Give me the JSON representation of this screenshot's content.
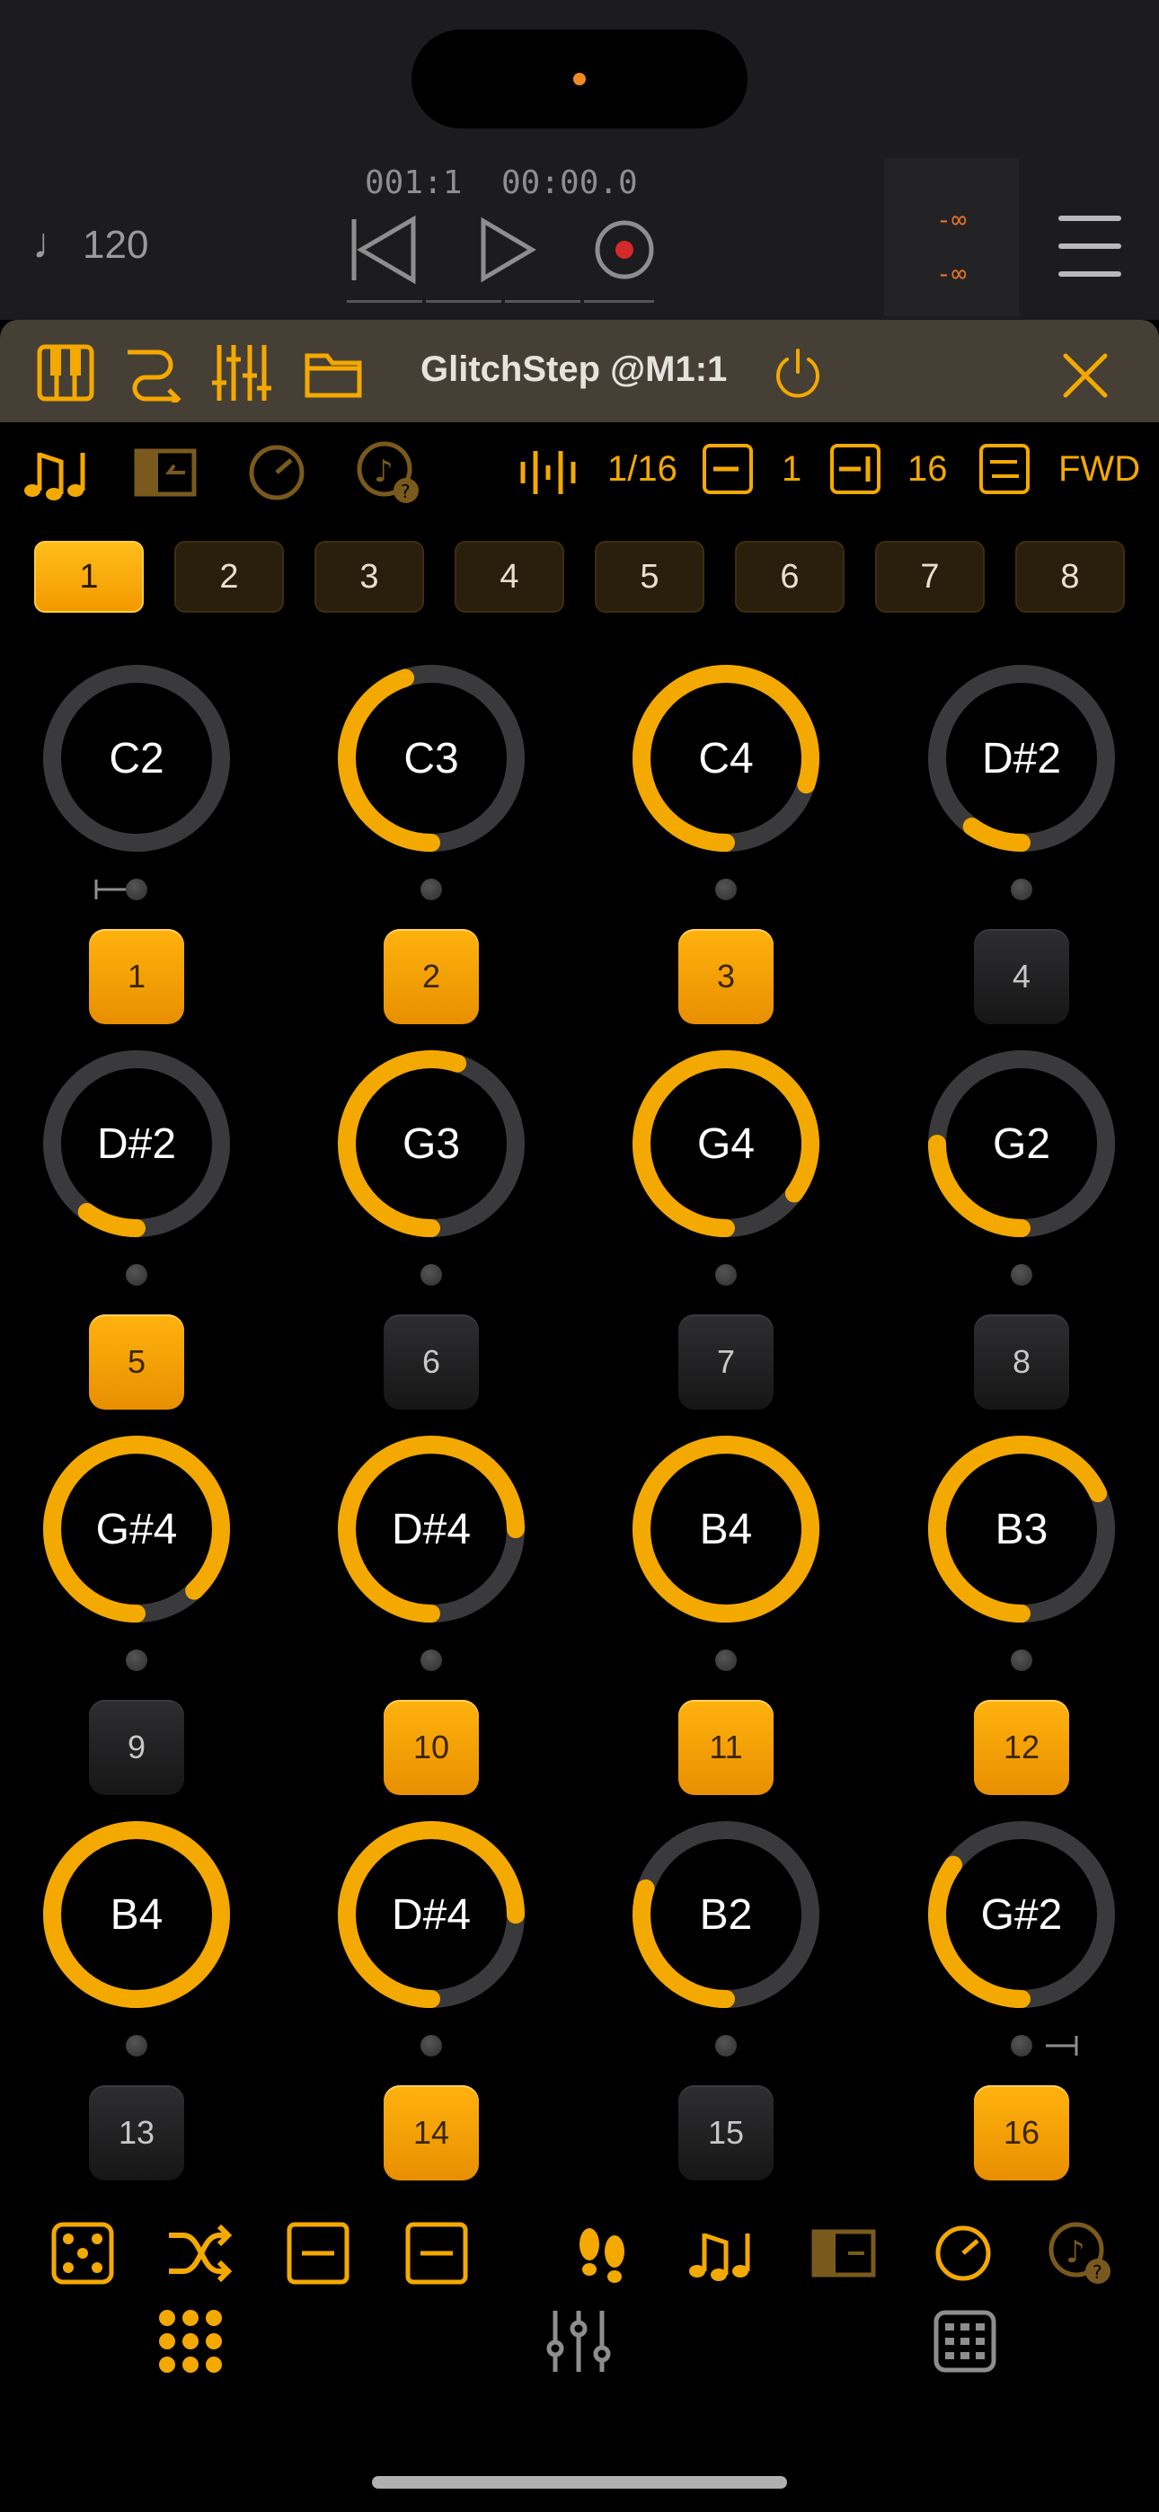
{
  "transport": {
    "tempo": "120",
    "tempo_icon": "note-icon",
    "position_bars": "001:1",
    "position_time": "00:00.0",
    "meter_left": "-∞",
    "meter_right": "-∞"
  },
  "plugin": {
    "title": "GlitchStep @M1:1"
  },
  "toolbar": {
    "division": "1/16",
    "start_step": "1",
    "end_step": "16",
    "direction": "FWD"
  },
  "patterns": [
    "1",
    "2",
    "3",
    "4",
    "5",
    "6",
    "7",
    "8"
  ],
  "selected_pattern": "1",
  "steps": [
    {
      "note": "C2",
      "level": 0.0,
      "button": "1",
      "on": true
    },
    {
      "note": "C3",
      "level": 0.45,
      "button": "2",
      "on": true
    },
    {
      "note": "C4",
      "level": 0.8,
      "button": "3",
      "on": true
    },
    {
      "note": "D#2",
      "level": 0.1,
      "button": "4",
      "on": false
    },
    {
      "note": "D#2",
      "level": 0.1,
      "button": "5",
      "on": true
    },
    {
      "note": "G3",
      "level": 0.55,
      "button": "6",
      "on": false
    },
    {
      "note": "G4",
      "level": 0.85,
      "button": "7",
      "on": false
    },
    {
      "note": "G2",
      "level": 0.25,
      "button": "8",
      "on": false
    },
    {
      "note": "G#4",
      "level": 0.88,
      "button": "9",
      "on": false
    },
    {
      "note": "D#4",
      "level": 0.75,
      "button": "10",
      "on": true
    },
    {
      "note": "B4",
      "level": 1.0,
      "button": "11",
      "on": true
    },
    {
      "note": "B3",
      "level": 0.68,
      "button": "12",
      "on": true
    },
    {
      "note": "B4",
      "level": 1.0,
      "button": "13",
      "on": false
    },
    {
      "note": "D#4",
      "level": 0.75,
      "button": "14",
      "on": true
    },
    {
      "note": "B2",
      "level": 0.3,
      "button": "15",
      "on": false
    },
    {
      "note": "G#2",
      "level": 0.35,
      "button": "16",
      "on": true
    }
  ],
  "colors": {
    "accent": "#f4a900",
    "knob_track": "#3a3a3c"
  }
}
